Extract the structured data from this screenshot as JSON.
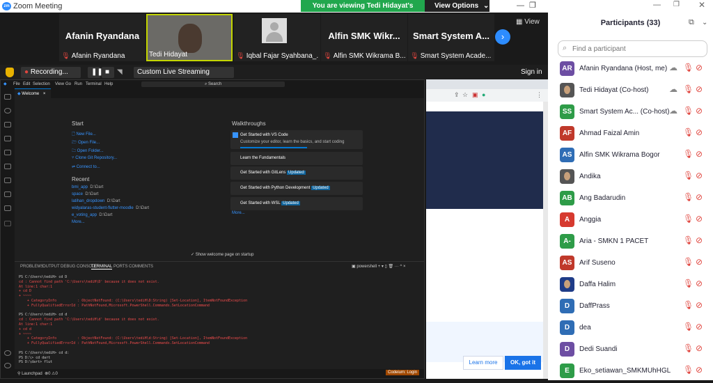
{
  "window": {
    "title": "Zoom Meeting",
    "logo": "zm"
  },
  "banner": {
    "text": "You are viewing Tedi Hidayat's screen",
    "view_options": "View Options"
  },
  "thumbs": [
    {
      "name": "Afanin Ryandana",
      "label": "Afanin Ryandana",
      "video": false
    },
    {
      "name": "",
      "label": "Tedi Hidayat",
      "video": true
    },
    {
      "name": "",
      "label": "Iqbal Fajar Syahbana_...",
      "video": false,
      "avatar": true
    },
    {
      "name": "Alfin SMK Wikr...",
      "label": "Alfin SMK Wikrama B...",
      "video": false
    },
    {
      "name": "Smart System A...",
      "label": "Smart System Acade...",
      "video": false
    }
  ],
  "view_label": "View",
  "sharebar": {
    "recording": "Recording...",
    "streaming": "Custom Live Streaming Service",
    "signin": "Sign in"
  },
  "vscode": {
    "menu": [
      "File",
      "Edit",
      "Selection",
      "View",
      "Go",
      "Run",
      "Terminal",
      "Help"
    ],
    "search": "Search",
    "tab": "Welcome",
    "start_title": "Start",
    "start_items": [
      "New File...",
      "Open File...",
      "Open Folder...",
      "Clone Git Repository...",
      "Connect to..."
    ],
    "recent_title": "Recent",
    "recent": [
      {
        "name": "bmi_app",
        "path": "D:\\Dart"
      },
      {
        "name": "space",
        "path": "D:\\Dart"
      },
      {
        "name": "latihan_dropdown",
        "path": "D:\\Dart"
      },
      {
        "name": "widyalaras-student-flutter-moodle",
        "path": "D:\\Dart"
      },
      {
        "name": "e_voting_app",
        "path": "D:\\Dart"
      }
    ],
    "more": "More...",
    "walk_title": "Walkthroughs",
    "walk": [
      {
        "title": "Get Started with VS Code",
        "desc": "Customize your editor, learn the basics, and start coding",
        "badge": ""
      },
      {
        "title": "Learn the Fundamentals",
        "desc": "",
        "badge": ""
      },
      {
        "title": "Get Started with GitLens",
        "desc": "",
        "badge": "Updated"
      },
      {
        "title": "Get Started with Python Development",
        "desc": "",
        "badge": "Updated"
      },
      {
        "title": "Get Started with WSL",
        "desc": "",
        "badge": "Updated"
      }
    ],
    "show_welcome": "Show welcome page on startup",
    "panel_tabs": [
      "PROBLEMS",
      "OUTPUT",
      "DEBUG CONSOLE",
      "TERMINAL",
      "PORTS",
      "COMMENTS"
    ],
    "shell": "powershell",
    "terminal": [
      {
        "t": "PS C:\\Users\\tediH> cd D",
        "e": false
      },
      {
        "t": "cd : Cannot find path 'C:\\Users\\tediH\\D' because it does not exist.",
        "e": true
      },
      {
        "t": "At line:1 char:1",
        "e": true
      },
      {
        "t": "+ cd D",
        "e": true
      },
      {
        "t": "+ ~~~~",
        "e": true
      },
      {
        "t": "    + CategoryInfo          : ObjectNotFound: (C:\\Users\\tediH\\D:String) [Set-Location], ItemNotFoundException",
        "e": true
      },
      {
        "t": "    + FullyQualifiedErrorId : PathNotFound,Microsoft.PowerShell.Commands.SetLocationCommand",
        "e": true
      },
      {
        "t": "",
        "e": false
      },
      {
        "t": "PS C:\\Users\\tediH> cd d",
        "e": false
      },
      {
        "t": "cd : Cannot find path 'C:\\Users\\tediH\\d' because it does not exist.",
        "e": true
      },
      {
        "t": "At line:1 char:1",
        "e": true
      },
      {
        "t": "+ cd d",
        "e": true
      },
      {
        "t": "+ ~~~~",
        "e": true
      },
      {
        "t": "    + CategoryInfo          : ObjectNotFound: (C:\\Users\\tediH\\d:String) [Set-Location], ItemNotFoundException",
        "e": true
      },
      {
        "t": "    + FullyQualifiedErrorId : PathNotFound,Microsoft.PowerShell.Commands.SetLocationCommand",
        "e": true
      },
      {
        "t": "",
        "e": false
      },
      {
        "t": "PS C:\\Users\\tediH> cd d:",
        "e": false
      },
      {
        "t": "PS D:\\> cd dart",
        "e": false
      },
      {
        "t": "PS D:\\dart> flut",
        "e": false
      }
    ],
    "status_left": "Launchpad",
    "status_right": "Codeium: Login"
  },
  "browser": {
    "learn_more": "Learn more",
    "ok": "OK, got it"
  },
  "participants": {
    "title": "Participants (33)",
    "search_placeholder": "Find a participant",
    "list": [
      {
        "initials": "AR",
        "name": "Afanin Ryandana (Host, me)",
        "color": "#6d4ea3",
        "photo": false
      },
      {
        "initials": "",
        "name": "Tedi Hidayat (Co-host)",
        "color": "#555",
        "photo": true
      },
      {
        "initials": "SS",
        "name": "Smart System Ac... (Co-host)",
        "color": "#2e9c48",
        "photo": false
      },
      {
        "initials": "AF",
        "name": "Ahmad Faizal Amin",
        "color": "#c0392b",
        "photo": false
      },
      {
        "initials": "AS",
        "name": "Alfin SMK Wikrama Bogor",
        "color": "#2f6db5",
        "photo": false
      },
      {
        "initials": "",
        "name": "Andika",
        "color": "#555",
        "photo": true
      },
      {
        "initials": "AB",
        "name": "Ang Badarudin",
        "color": "#2e9c48",
        "photo": false
      },
      {
        "initials": "A",
        "name": "Anggia",
        "color": "#d63a2f",
        "photo": false
      },
      {
        "initials": "A-",
        "name": "Aria - SMKN 1 PACET",
        "color": "#2e9c48",
        "photo": false
      },
      {
        "initials": "AS",
        "name": "Arif Suseno",
        "color": "#c0392b",
        "photo": false
      },
      {
        "initials": "",
        "name": "Daffa Halim",
        "color": "#1f3c88",
        "photo": true
      },
      {
        "initials": "D",
        "name": "DaffPrass",
        "color": "#2f6db5",
        "photo": false
      },
      {
        "initials": "D",
        "name": "dea",
        "color": "#2f6db5",
        "photo": false
      },
      {
        "initials": "D",
        "name": "Dedi Suandi",
        "color": "#6d4ea3",
        "photo": false
      },
      {
        "initials": "E",
        "name": "Eko_setiawan_SMKMUhHGL",
        "color": "#2e9c48",
        "photo": false
      }
    ]
  }
}
